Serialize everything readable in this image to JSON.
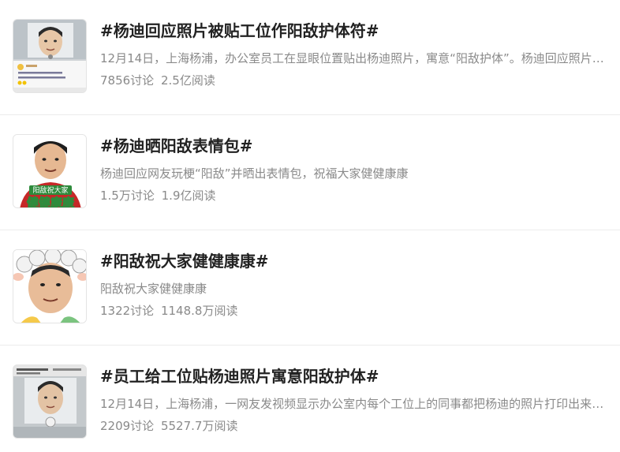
{
  "topics": [
    {
      "title": "#杨迪回应照片被贴工位作阳敌护体符#",
      "description": "12月14日，上海杨浦，办公室员工在显眼位置贴出杨迪照片，寓意“阳敌护体”。杨迪回应照片被贴工位作阳敌护体符",
      "discussions": "7856讨论",
      "reads": "2.5亿阅读",
      "thumb_icon": "office-photo-thumbnail"
    },
    {
      "title": "#杨迪晒阳敌表情包#",
      "description": "杨迪回应网友玩梗“阳敌”并晒出表情包，祝福大家健健康康",
      "discussions": "1.5万讨论",
      "reads": "1.9亿阅读",
      "thumb_icon": "sticker-thumbnail",
      "thumb_caption_small": "阳敌祝大家",
      "thumb_caption_big": "健健康康"
    },
    {
      "title": "#阳敌祝大家健健康康#",
      "description": "阳敌祝大家健健康康",
      "discussions": "1322讨论",
      "reads": "1148.8万阅读",
      "thumb_icon": "cartoon-sheep-face-thumbnail"
    },
    {
      "title": "#员工给工位贴杨迪照片寓意阳敌护体#",
      "description": "12月14日，上海杨浦，一网友发视频显示办公室内每个工位上的同事都把杨迪的照片打印出来贴在工位上",
      "discussions": "2209讨论",
      "reads": "5527.7万阅读",
      "thumb_icon": "office-photo-thumbnail"
    }
  ],
  "colors": {
    "title": "#222222",
    "meta": "#8a8a8a",
    "divider": "#ececec",
    "sticker_green": "#2e8b3c"
  }
}
